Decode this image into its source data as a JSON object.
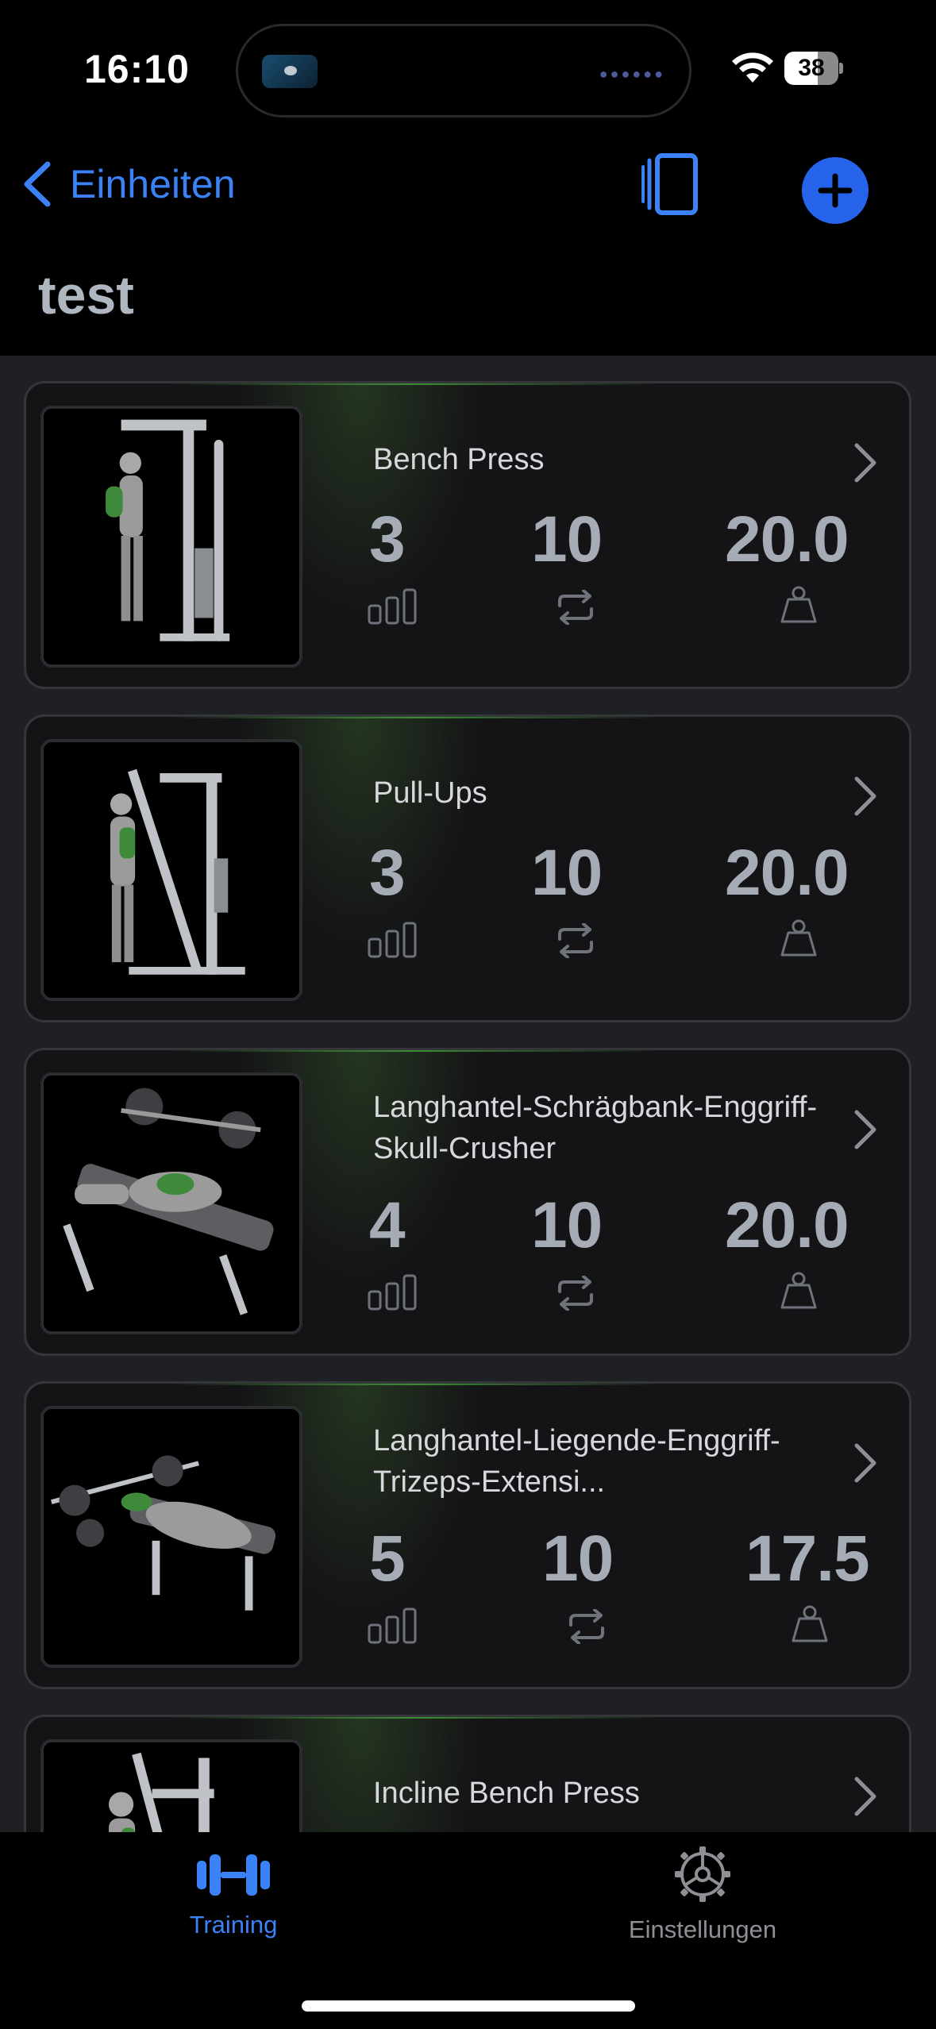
{
  "status_bar": {
    "time": "16:10",
    "battery": "38"
  },
  "nav": {
    "back_label": "Einheiten"
  },
  "page": {
    "title": "test"
  },
  "exercises": [
    {
      "name": "Bench Press",
      "sets": "3",
      "reps": "10",
      "weight": "20.0"
    },
    {
      "name": "Pull-Ups",
      "sets": "3",
      "reps": "10",
      "weight": "20.0"
    },
    {
      "name": "Langhantel-Schrägbank-Enggriff-Skull-Crusher",
      "sets": "4",
      "reps": "10",
      "weight": "20.0"
    },
    {
      "name": "Langhantel-Liegende-Enggriff-Trizeps-Extensi...",
      "sets": "5",
      "reps": "10",
      "weight": "17.5"
    },
    {
      "name": "Incline Bench Press"
    }
  ],
  "tabs": [
    {
      "label": "Training",
      "icon": "dumbbell-icon",
      "active": true
    },
    {
      "label": "Einstellungen",
      "icon": "gear-icon",
      "active": false
    }
  ],
  "colors": {
    "accent": "#3b82f6",
    "background": "#000000",
    "list_bg": "#1f2023",
    "card_bg": "#141416",
    "stat_text": "#a5acb6"
  }
}
